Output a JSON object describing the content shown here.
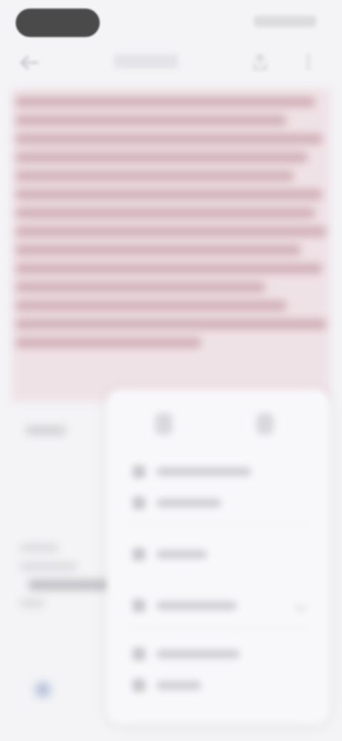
{
  "status_bar": {
    "time": "",
    "icons": [
      "signal-icon",
      "wifi-icon",
      "battery-icon"
    ]
  },
  "header": {
    "title": "",
    "actions": [
      "share-icon",
      "more-icon"
    ]
  },
  "content": {
    "highlight_color": "#efe2e6",
    "text": ""
  },
  "popup": {
    "items": [
      {
        "icon": "copy-icon",
        "label": ""
      },
      {
        "icon": "select-all-icon",
        "label": ""
      },
      {
        "icon": "highlight-icon",
        "label": ""
      },
      {
        "icon": "translate-icon",
        "label": ""
      },
      {
        "icon": "search-icon",
        "label": ""
      },
      {
        "icon": "share-icon",
        "label": ""
      }
    ]
  }
}
